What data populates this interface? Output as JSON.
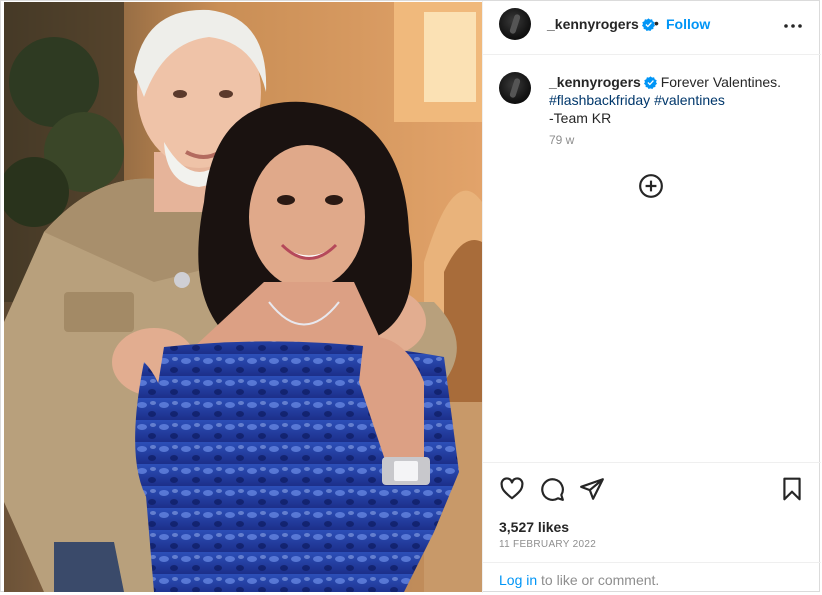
{
  "post": {
    "photo_alt": "Photo of an older man in a tan western shirt standing behind a smiling woman in a blue printed off-shoulder top",
    "header": {
      "username": "_kennyrogers",
      "separator": "•",
      "follow_label": "Follow"
    },
    "caption": {
      "username": "_kennyrogers",
      "text": " Forever Valentines.",
      "hashtags": [
        "#flashbackfriday",
        "#valentines"
      ],
      "signoff": "-Team KR",
      "time_ago": "79 w"
    },
    "engagement": {
      "likes": "3,527 likes",
      "date": "11 FEBRUARY 2022"
    },
    "login_prompt": {
      "link": "Log in",
      "rest": " to like or comment."
    }
  },
  "colors": {
    "accent": "#0095f6",
    "hashtag": "#00376b",
    "muted": "#8e8e8e",
    "border": "#dbdbdb"
  },
  "icons": {
    "more": "more-horizontal-icon",
    "verified": "verified-badge-icon",
    "load_more": "circle-plus-icon",
    "like": "heart-icon",
    "comment": "comment-bubble-icon",
    "share": "paper-plane-icon",
    "save": "bookmark-icon"
  }
}
